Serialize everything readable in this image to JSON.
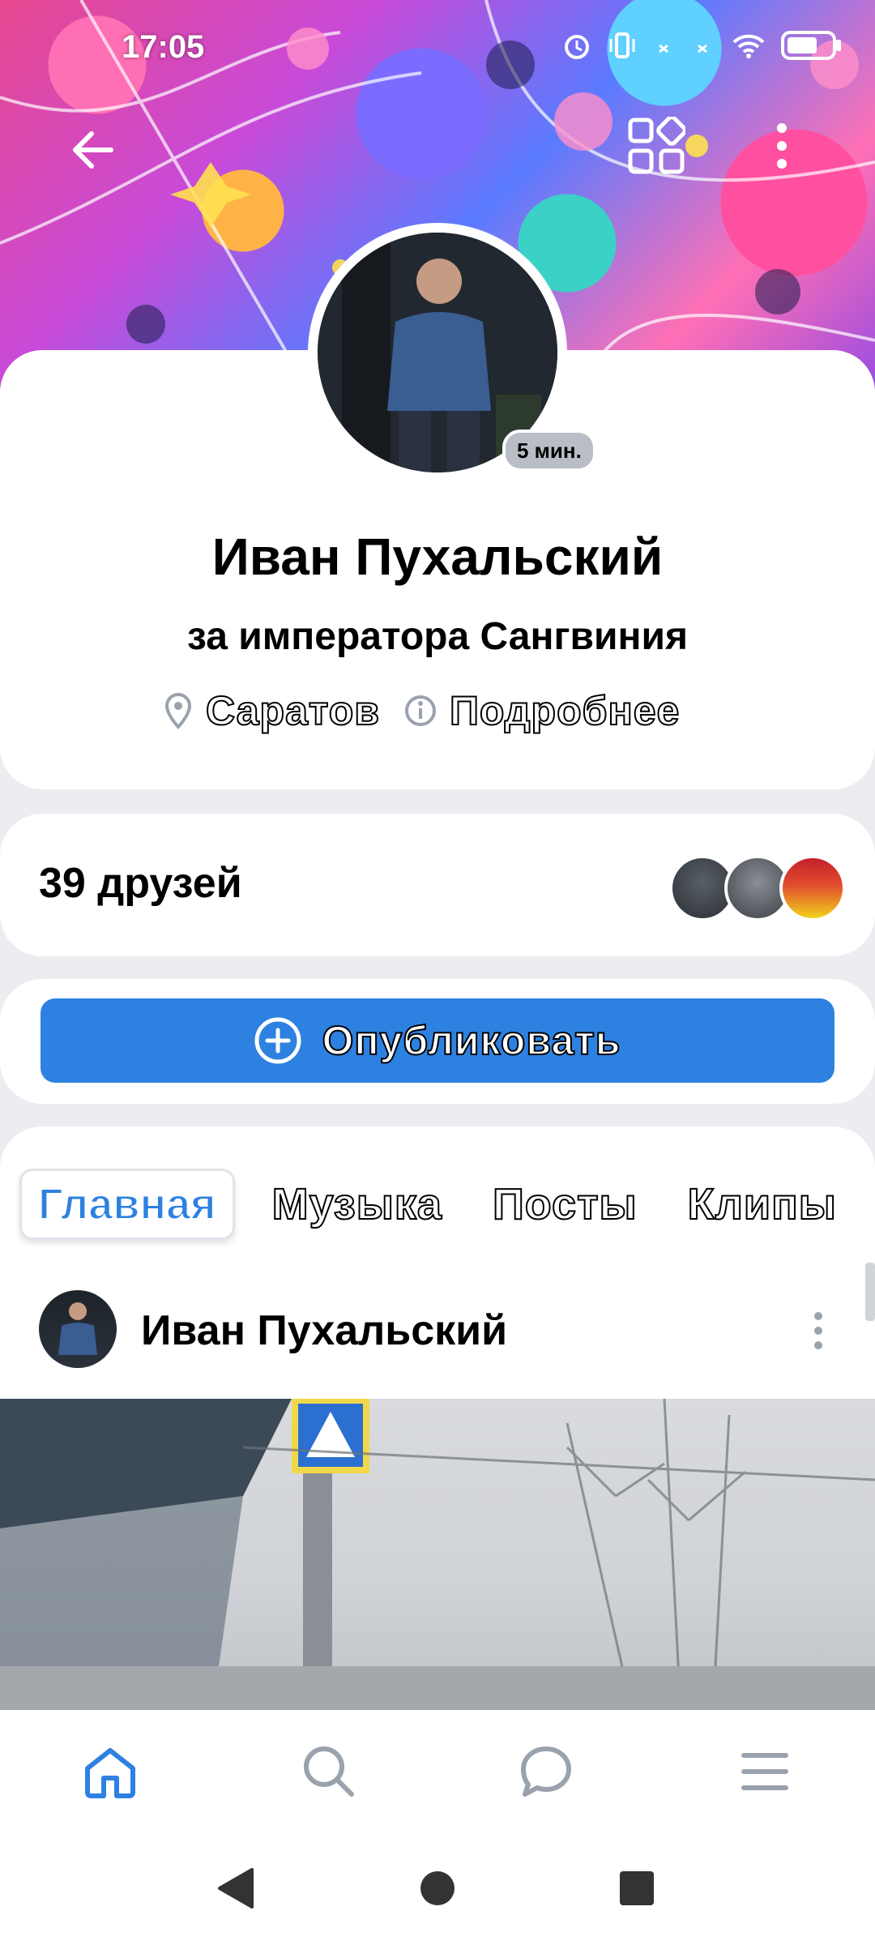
{
  "statusbar": {
    "time": "17:05"
  },
  "profile": {
    "name": "Иван Пухальский",
    "status": "за императора Сангвиния",
    "online_badge": "5 мин.",
    "city": "Саратов",
    "more_label": "Подробнее"
  },
  "friends": {
    "title": "39 друзей"
  },
  "publish": {
    "label": "Опубликовать"
  },
  "tabs": [
    {
      "label": "Главная",
      "active": true
    },
    {
      "label": "Музыка"
    },
    {
      "label": "Посты"
    },
    {
      "label": "Клипы"
    }
  ],
  "post": {
    "author": "Иван Пухальский"
  },
  "bottom_nav": [
    "home-icon",
    "search-icon",
    "messages-icon",
    "menu-icon"
  ],
  "system_nav": [
    "back-icon",
    "home-circle-icon",
    "recents-icon"
  ],
  "colors": {
    "accent": "#2d81e0",
    "background": "#ebedf0"
  }
}
